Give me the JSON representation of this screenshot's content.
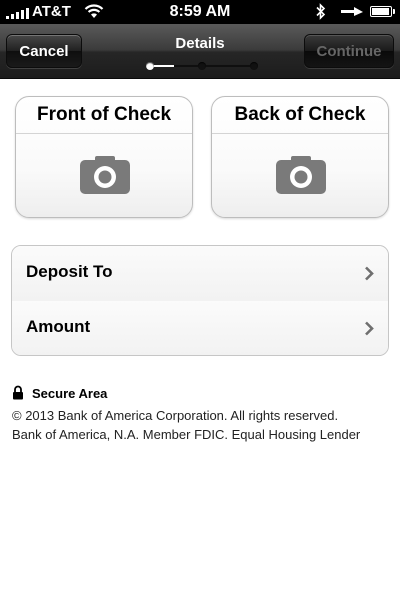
{
  "status_bar": {
    "carrier": "AT&T",
    "time": "8:59 AM",
    "icons": [
      "signal-icon",
      "wifi-icon",
      "bluetooth-icon",
      "charging-icon",
      "battery-icon"
    ]
  },
  "nav": {
    "title": "Details",
    "cancel_label": "Cancel",
    "continue_label": "Continue",
    "progress": {
      "steps": 3,
      "current": 1
    }
  },
  "check": {
    "front_label": "Front of Check",
    "back_label": "Back of Check",
    "icon": "camera-icon"
  },
  "form": {
    "rows": [
      {
        "label": "Deposit To"
      },
      {
        "label": "Amount"
      }
    ]
  },
  "footer": {
    "secure_label": "Secure Area",
    "copyright": "© 2013  Bank of America Corporation. All rights reserved.",
    "member": "Bank of America, N.A. Member FDIC. Equal Housing Lender"
  },
  "colors": {
    "nav_bar": "#2e2e2e",
    "status_bar": "#000000",
    "icon_gray": "#7a7a7a",
    "background": "#ffffff"
  }
}
